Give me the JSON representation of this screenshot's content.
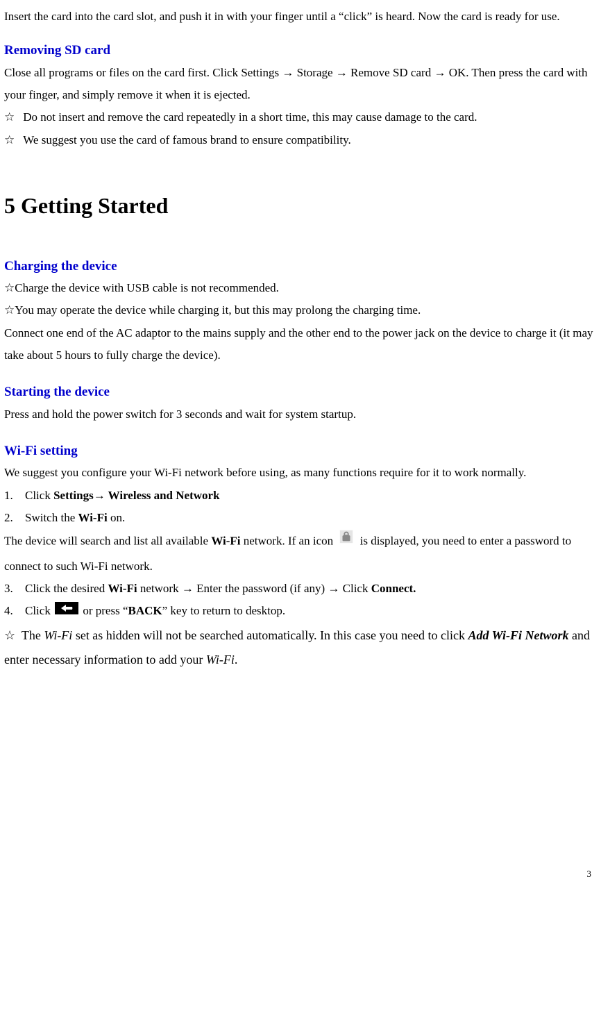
{
  "intro": {
    "p1": "Insert the card into the card slot, and push it in with your finger until a “click” is heard. Now the card is ready for use."
  },
  "removing": {
    "title": "Removing SD card",
    "p1": "Close all programs or files on the card first. Click Settings → Storage → Remove SD card → OK. Then press the card with your finger, and simply remove it when it is ejected.",
    "b1": "Do not insert and remove the card repeatedly in a short time, this may cause damage to the card.",
    "b2": "We suggest you use the card of famous brand to ensure compatibility."
  },
  "chapter_title": "5 Getting Started",
  "charging": {
    "title": "Charging the device",
    "b1": "Charge the device with USB cable is not recommended.",
    "b2": "You may operate the device while charging it, but this may prolong the charging time.",
    "p1": "Connect one end of the AC adaptor to the mains supply and the other end to the power jack on the device to charge it (it may take about 5 hours to fully charge the device)."
  },
  "starting": {
    "title": "Starting the device",
    "p1": "Press and hold the power switch for 3 seconds and wait for system startup."
  },
  "wifi": {
    "title": "Wi-Fi setting",
    "intro": "We suggest you configure your Wi-Fi network before using, as many functions require for it to work normally.",
    "s1_pre": "Click ",
    "s1_bold": "Settings→ Wireless and Network",
    "s2_pre": "Switch the ",
    "s2_bold": "Wi-Fi",
    "s2_post": " on.",
    "mid_a": "The device will search and list all available ",
    "mid_b": "Wi-Fi",
    "mid_c": " network. If an icon ",
    "mid_d": " is displayed, you need to enter a password to connect to such Wi-Fi network.",
    "s3_a": "Click the desired ",
    "s3_b": "Wi-Fi",
    "s3_c": " network  →  Enter the password (if any)  →  Click ",
    "s3_d": "Connect.",
    "s4_a": "Click ",
    "s4_b": " or press  “",
    "s4_c": "BACK",
    "s4_d": "”   key to return to desktop.",
    "note_a": "The ",
    "note_b": "Wi-Fi",
    "note_c": " set as hidden will not be searched automatically. In this case you need to click ",
    "note_d": "Add Wi-Fi Network",
    "note_e": " and enter necessary information to add your ",
    "note_f": "Wi-Fi",
    "note_g": "."
  },
  "star": "☆",
  "page_number": "3"
}
